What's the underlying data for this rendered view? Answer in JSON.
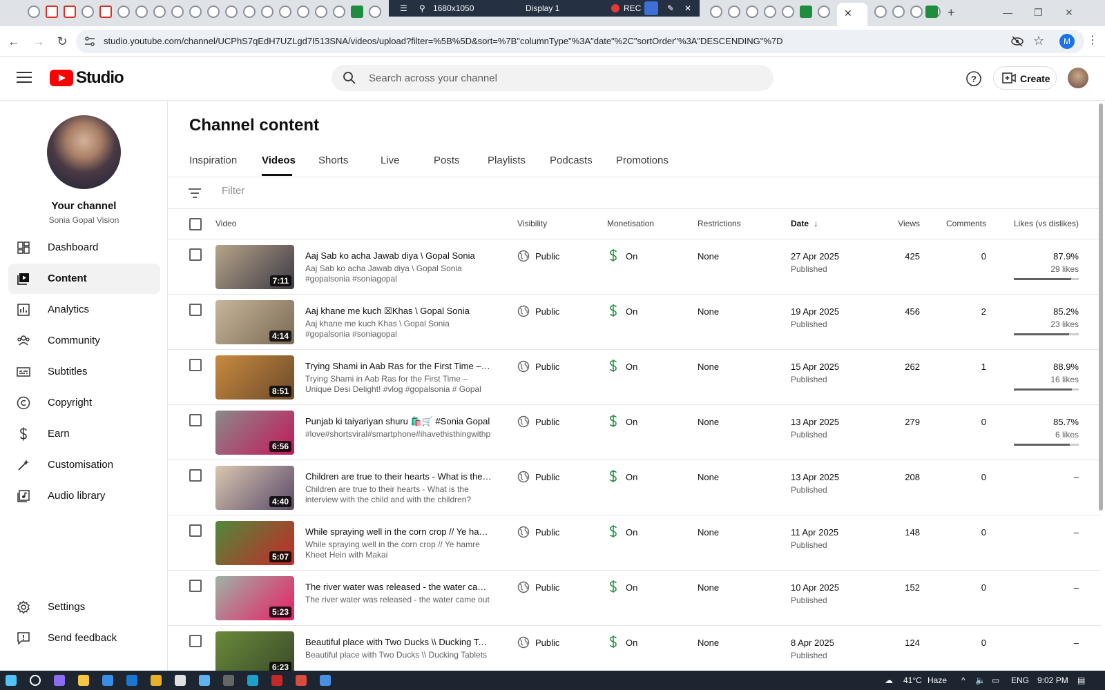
{
  "browser": {
    "url": "studio.youtube.com/channel/UCPhS7qEdH7UZLgd7I513SNA/videos/upload?filter=%5B%5D&sort=%7B\"columnType\"%3A\"date\"%2C\"sortOrder\"%3A\"DESCENDING\"%7D",
    "recorder": {
      "resolution": "1680x1050",
      "display": "Display 1",
      "rec_label": "REC"
    },
    "profile_initial": "M"
  },
  "header": {
    "logo_text": "Studio",
    "search_placeholder": "Search across your channel",
    "create_label": "Create"
  },
  "sidebar": {
    "your_channel": "Your channel",
    "channel_name": "Sonia Gopal Vision",
    "items": [
      {
        "label": "Dashboard",
        "icon": "dashboard-icon"
      },
      {
        "label": "Content",
        "icon": "content-icon"
      },
      {
        "label": "Analytics",
        "icon": "analytics-icon"
      },
      {
        "label": "Community",
        "icon": "community-icon"
      },
      {
        "label": "Subtitles",
        "icon": "subtitles-icon"
      },
      {
        "label": "Copyright",
        "icon": "copyright-icon"
      },
      {
        "label": "Earn",
        "icon": "earn-icon"
      },
      {
        "label": "Customisation",
        "icon": "customisation-icon"
      },
      {
        "label": "Audio library",
        "icon": "audio-library-icon"
      }
    ],
    "settings": "Settings",
    "feedback": "Send feedback"
  },
  "main": {
    "title": "Channel content",
    "tabs": [
      "Inspiration",
      "Videos",
      "Shorts",
      "Live",
      "Posts",
      "Playlists",
      "Podcasts",
      "Promotions"
    ],
    "active_tab": "Videos",
    "filter_placeholder": "Filter",
    "columns": {
      "video": "Video",
      "visibility": "Visibility",
      "monetisation": "Monetisation",
      "restrictions": "Restrictions",
      "date": "Date",
      "views": "Views",
      "comments": "Comments",
      "likes": "Likes (vs dislikes)"
    },
    "videos": [
      {
        "title": "Aaj Sab ko acha Jawab diya \\ Gopal Sonia",
        "desc": "Aaj Sab ko acha Jawab diya \\ Gopal Sonia #gopalsonia #soniagopal",
        "duration": "7:11",
        "visibility": "Public",
        "monetisation": "On",
        "restrictions": "None",
        "date": "27 Apr 2025",
        "status": "Published",
        "views": "425",
        "comments": "0",
        "likes_pct": "87.9%",
        "likes_count": "29 likes",
        "likes_ratio": 0.879,
        "thumb_colors": [
          "#b7a58a",
          "#3d3a45"
        ]
      },
      {
        "title": "Aaj khane me kuch ☒Khas \\ Gopal Sonia",
        "desc": "Aaj khane me kuch Khas \\ Gopal Sonia #gopalsonia #soniagopal",
        "duration": "4:14",
        "visibility": "Public",
        "monetisation": "On",
        "restrictions": "None",
        "date": "19 Apr 2025",
        "status": "Published",
        "views": "456",
        "comments": "2",
        "likes_pct": "85.2%",
        "likes_count": "23 likes",
        "likes_ratio": 0.852,
        "thumb_colors": [
          "#c8b59a",
          "#7a6a55"
        ]
      },
      {
        "title": "Trying Shami in Aab Ras for the First Time – Un...",
        "desc": "Trying Shami in Aab Ras for the First Time – Unique Desi Delight! #vlog #gopalsonia # Gopal Sonia log",
        "duration": "8:51",
        "visibility": "Public",
        "monetisation": "On",
        "restrictions": "None",
        "date": "15 Apr 2025",
        "status": "Published",
        "views": "262",
        "comments": "1",
        "likes_pct": "88.9%",
        "likes_count": "16 likes",
        "likes_ratio": 0.889,
        "thumb_colors": [
          "#c98a3e",
          "#6b4a2b"
        ]
      },
      {
        "title": "Punjab ki taiyariyan shuru 🛍️🛒 #Sonia Gopal",
        "desc": "#love#shortsviral#smartphone#ihavethisthingwithp",
        "duration": "6:56",
        "visibility": "Public",
        "monetisation": "On",
        "restrictions": "None",
        "date": "13 Apr 2025",
        "status": "Published",
        "views": "279",
        "comments": "0",
        "likes_pct": "85.7%",
        "likes_count": "6 likes",
        "likes_ratio": 0.857,
        "thumb_colors": [
          "#8a8a8a",
          "#c2185b"
        ]
      },
      {
        "title": "Children are true to their hearts - What is the int...",
        "desc": "Children are true to their hearts - What is the interview with the child and with the children?",
        "duration": "4:40",
        "visibility": "Public",
        "monetisation": "On",
        "restrictions": "None",
        "date": "13 Apr 2025",
        "status": "Published",
        "views": "208",
        "comments": "0",
        "likes_pct": "–",
        "likes_count": "",
        "likes_ratio": null,
        "thumb_colors": [
          "#d9c7b0",
          "#5a4a6a"
        ]
      },
      {
        "title": "While spraying well in the corn crop // Ye hamre...",
        "desc": "While spraying well in the corn crop // Ye hamre Kheet Hein with Makai",
        "duration": "5:07",
        "visibility": "Public",
        "monetisation": "On",
        "restrictions": "None",
        "date": "11 Apr 2025",
        "status": "Published",
        "views": "148",
        "comments": "0",
        "likes_pct": "–",
        "likes_count": "",
        "likes_ratio": null,
        "thumb_colors": [
          "#4f8a3a",
          "#c62828"
        ]
      },
      {
        "title": "The river water was released - the water came ...",
        "desc": "The river water was released - the water came out",
        "duration": "5:23",
        "visibility": "Public",
        "monetisation": "On",
        "restrictions": "None",
        "date": "10 Apr 2025",
        "status": "Published",
        "views": "152",
        "comments": "0",
        "likes_pct": "–",
        "likes_count": "",
        "likes_ratio": null,
        "thumb_colors": [
          "#9db3a8",
          "#e91e63"
        ]
      },
      {
        "title": "Beautiful place with Two Ducks \\\\ Ducking Tabl...",
        "desc": "Beautiful place with Two Ducks \\\\ Ducking Tablets",
        "duration": "6:23",
        "visibility": "Public",
        "monetisation": "On",
        "restrictions": "None",
        "date": "8 Apr 2025",
        "status": "Published",
        "views": "124",
        "comments": "0",
        "likes_pct": "–",
        "likes_count": "",
        "likes_ratio": null,
        "thumb_colors": [
          "#6a8a3a",
          "#3a4a2a"
        ]
      }
    ]
  },
  "taskbar": {
    "weather": "41°C",
    "weather_desc": "Haze",
    "lang": "ENG",
    "time": "9:02 PM"
  },
  "colors": {
    "accent": "#ff0000",
    "text": "#0f0f0f",
    "muted": "#606060",
    "monetised": "#1e8e3e"
  }
}
